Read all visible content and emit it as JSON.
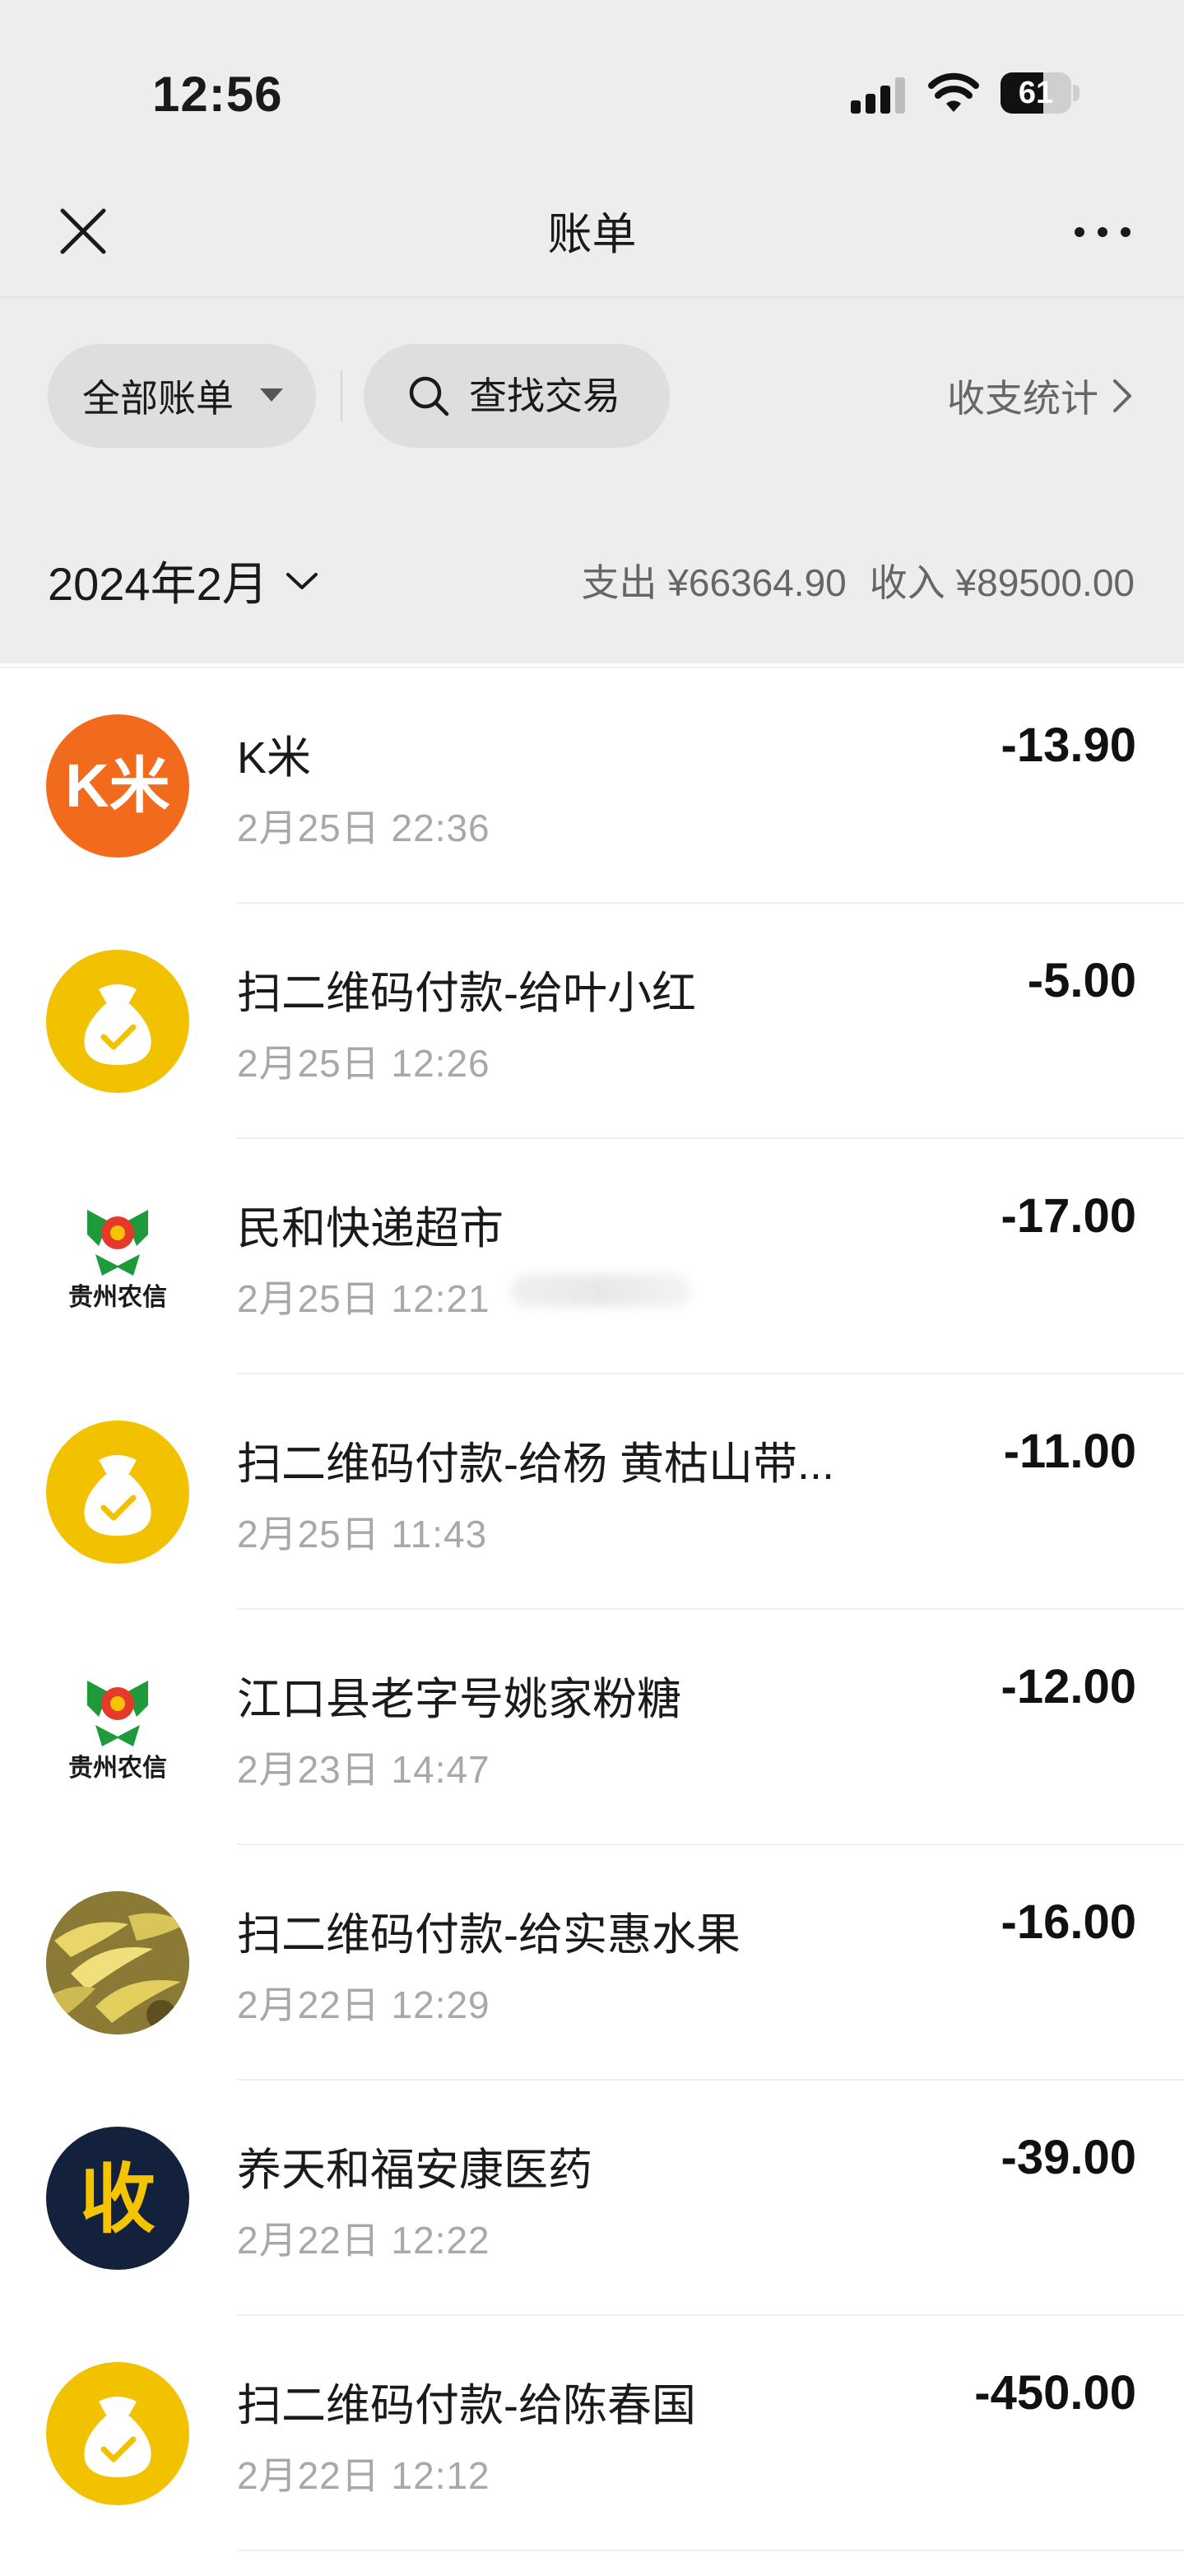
{
  "status_bar": {
    "time": "12:56",
    "battery": "61",
    "battery_level": 0.61
  },
  "header": {
    "title": "账单",
    "close_icon": "close-icon",
    "more_icon": "more-icon"
  },
  "filters": {
    "all_bills": "全部账单",
    "search": "查找交易",
    "stats": "收支统计"
  },
  "period": {
    "month": "2024年2月",
    "expense": "支出 ¥66364.90",
    "income": "收入 ¥89500.00"
  },
  "transactions": [
    {
      "name": "K米",
      "time": "2月25日 22:36",
      "amount": "-13.90",
      "icon": "kmi-logo",
      "color": "#f26a1b"
    },
    {
      "name": "扫二维码付款-给叶小红",
      "time": "2月25日 12:26",
      "amount": "-5.00",
      "icon": "money-bag-icon",
      "color": "#f2c200"
    },
    {
      "name": "民和快递超市",
      "time": "2月25日 12:21",
      "amount": "-17.00",
      "icon": "guizhou-rcc-logo",
      "logo_text": "贵州农信"
    },
    {
      "name": "扫二维码付款-给杨 黄枯山带...",
      "time": "2月25日 11:43",
      "amount": "-11.00",
      "icon": "money-bag-icon",
      "color": "#f2c200"
    },
    {
      "name": "江口县老字号姚家粉糖",
      "time": "2月23日 14:47",
      "amount": "-12.00",
      "icon": "guizhou-rcc-logo",
      "logo_text": "贵州农信"
    },
    {
      "name": "扫二维码付款-给实惠水果",
      "time": "2月22日 12:29",
      "amount": "-16.00",
      "icon": "banana-photo"
    },
    {
      "name": "养天和福安康医药",
      "time": "2月22日 12:22",
      "amount": "-39.00",
      "icon": "shou-logo",
      "logo_text": "收",
      "color": "#f5c400"
    },
    {
      "name": "扫二维码付款-给陈春国",
      "time": "2月22日 12:12",
      "amount": "-450.00",
      "icon": "money-bag-icon",
      "color": "#f2c200"
    }
  ]
}
